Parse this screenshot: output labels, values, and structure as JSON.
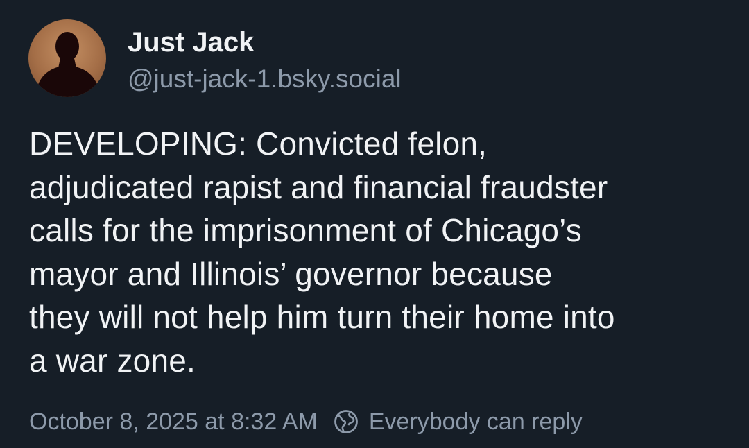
{
  "post": {
    "author": {
      "display_name": "Just Jack",
      "handle": "@just-jack-1.bsky.social",
      "avatar_icon": "person-silhouette-icon"
    },
    "text": "DEVELOPING: Convicted felon,\nadjudicated rapist and financial fraudster\ncalls for the imprisonment of Chicago’s\nmayor and Illinois’ governor because\nthey will not help him turn their home into\na war zone.",
    "timestamp": "October 8, 2025 at 8:32 AM",
    "reply_setting": {
      "icon": "globe-reply-icon",
      "label": "Everybody can reply"
    }
  },
  "colors": {
    "background": "#161e27",
    "primary_text": "#f1f3f5",
    "secondary_text": "#8d9aaa"
  }
}
